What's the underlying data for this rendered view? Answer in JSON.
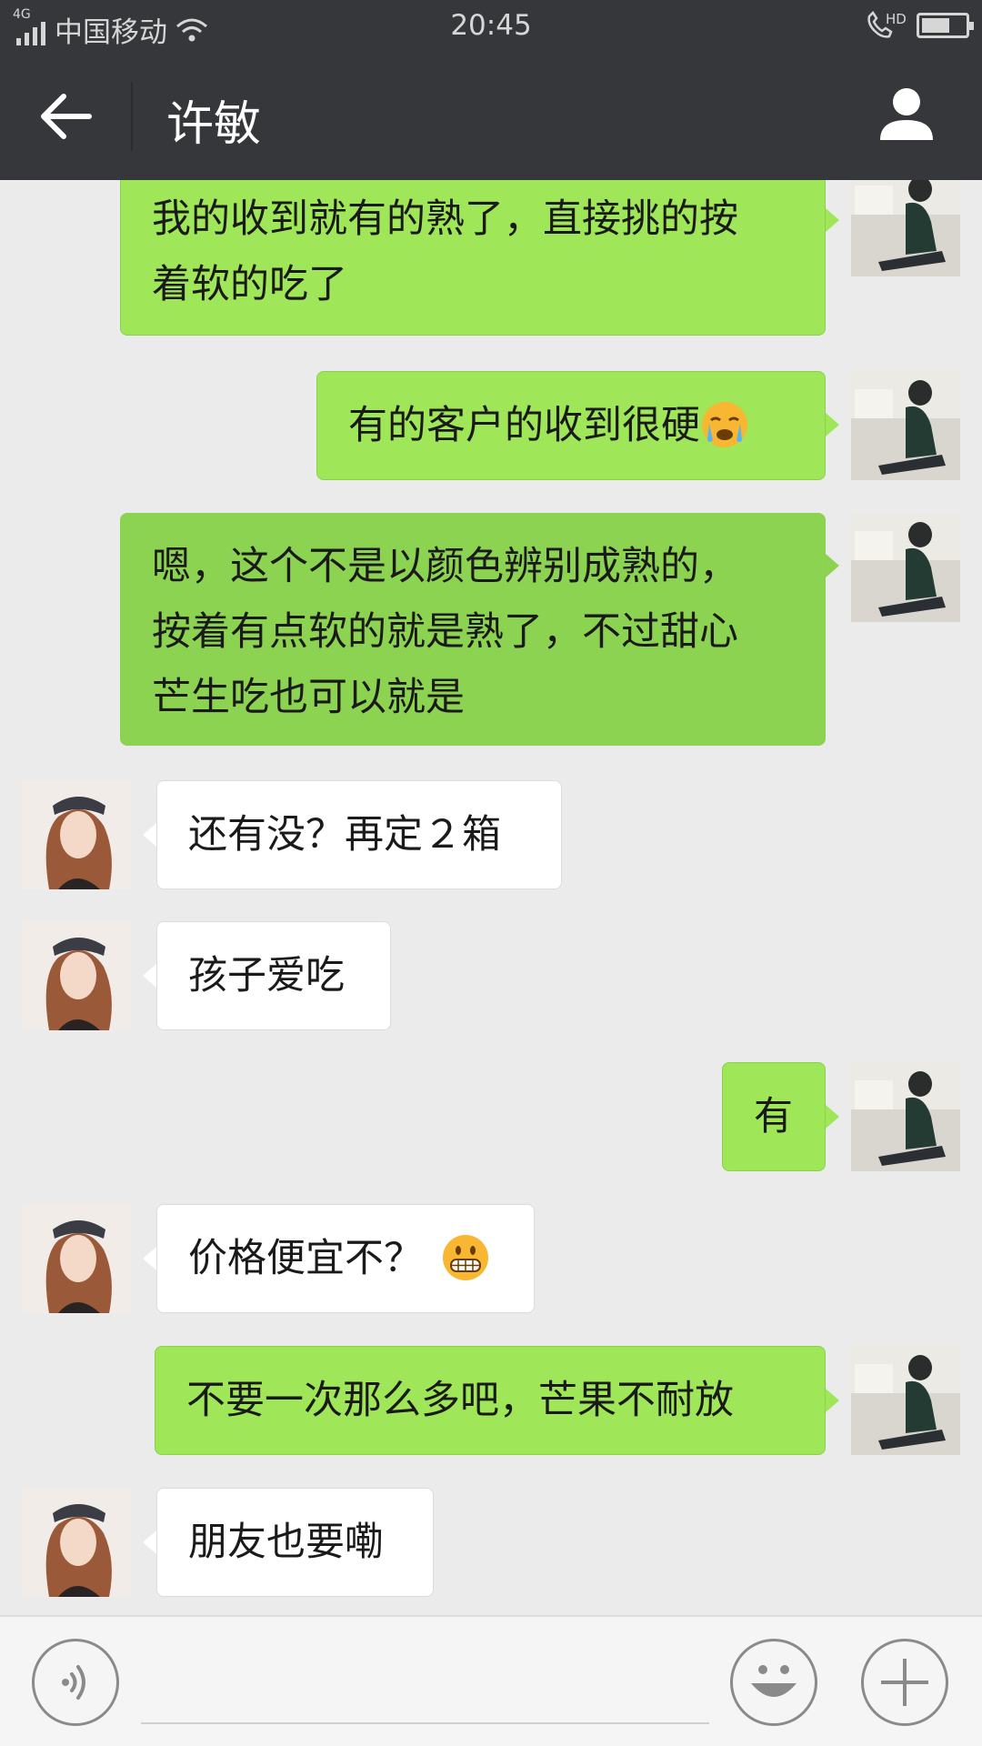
{
  "status_bar": {
    "network": "4G",
    "carrier": "中国移动",
    "time": "20:45",
    "call_tag": "HD",
    "battery_level": 0.65
  },
  "header": {
    "title": "许敏",
    "back_icon": "arrow-left-icon",
    "profile_icon": "person-icon"
  },
  "messages": [
    {
      "side": "out",
      "text_lines": [
        "我的收到就有的熟了，直接挑的按",
        "着软的吃了"
      ]
    },
    {
      "side": "out",
      "text": "有的客户的收到很硬",
      "emoji": "crying-face-icon"
    },
    {
      "side": "out",
      "text_lines": [
        "嗯，这个不是以颜色辨别成熟的，",
        "按着有点软的就是熟了，不过甜心",
        "芒生吃也可以就是"
      ]
    },
    {
      "side": "in",
      "text": "还有没？再定２箱"
    },
    {
      "side": "in",
      "text": "孩子爱吃"
    },
    {
      "side": "out",
      "text": "有"
    },
    {
      "side": "in",
      "text": "价格便宜不？",
      "emoji": "grinning-face-icon"
    },
    {
      "side": "out",
      "text": "不要一次那么多吧，芒果不耐放"
    },
    {
      "side": "in",
      "text": "朋友也要嘞"
    }
  ],
  "input_bar": {
    "voice_icon": "voice-icon",
    "emoji_icon": "smiley-icon",
    "plus_icon": "plus-icon",
    "input_value": ""
  },
  "colors": {
    "bar_bg": "#36373b",
    "chat_bg": "#ebebeb",
    "outgoing_bubble": "#9fe658",
    "incoming_bubble": "#ffffff"
  }
}
